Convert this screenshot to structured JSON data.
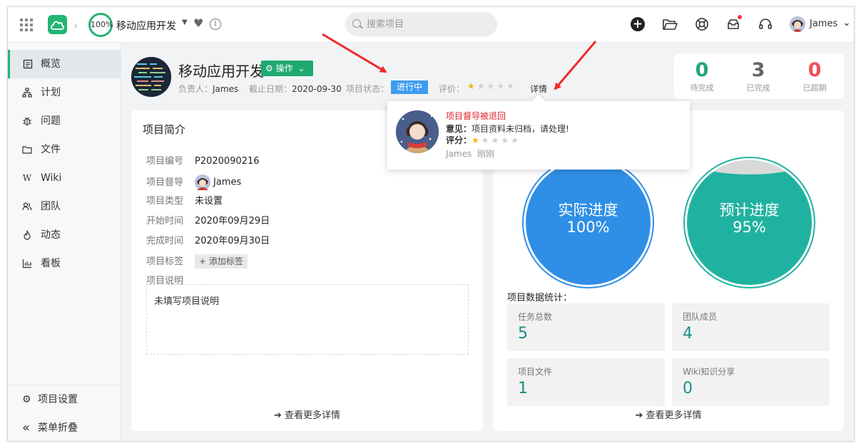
{
  "topbar": {
    "progress": "100%",
    "project_title": "移动应用开发",
    "search_placeholder": "搜索项目",
    "user_name": "James"
  },
  "sidebar": {
    "items": [
      {
        "label": "概览",
        "icon": "overview-icon"
      },
      {
        "label": "计划",
        "icon": "plan-icon"
      },
      {
        "label": "问题",
        "icon": "bug-icon"
      },
      {
        "label": "文件",
        "icon": "folder-icon"
      },
      {
        "label": "Wiki",
        "icon": "wiki-icon"
      },
      {
        "label": "团队",
        "icon": "team-icon"
      },
      {
        "label": "动态",
        "icon": "activity-icon"
      },
      {
        "label": "看板",
        "icon": "board-icon"
      }
    ],
    "settings_label": "项目设置",
    "collapse_label": "菜单折叠"
  },
  "header": {
    "name": "移动应用开发",
    "op_label": "操作",
    "owner_label": "负责人：",
    "owner": "James",
    "deadline_label": "截止日期：",
    "deadline": "2020-09-30",
    "status_label": "项目状态：",
    "status": "进行中",
    "rating_label": "评价：",
    "rating": 1,
    "rating_max": 5,
    "detail_label": "详情"
  },
  "stats": [
    {
      "num": "0",
      "label": "待完成",
      "color": "#1fa971"
    },
    {
      "num": "3",
      "label": "已完成",
      "color": "#666666"
    },
    {
      "num": "0",
      "label": "已超期",
      "color": "#f0505a"
    }
  ],
  "intro": {
    "title": "项目简介",
    "rows": [
      {
        "key": "项目编号",
        "value": "P2020090216"
      },
      {
        "key": "项目督导",
        "value": "James"
      },
      {
        "key": "项目类型",
        "value": "未设置"
      },
      {
        "key": "开始时间",
        "value": "2020年09月29日"
      },
      {
        "key": "完成时间",
        "value": "2020年09月30日"
      },
      {
        "key": "项目标签",
        "value": "添加标签"
      },
      {
        "key": "项目说明",
        "value": ""
      }
    ],
    "description": "未填写项目说明",
    "more_label": "查看更多详情"
  },
  "progress": {
    "actual_label": "实际进度",
    "actual_value": "100%",
    "planned_label": "预计进度",
    "planned_value": "95%",
    "colors": {
      "actual": "#2f8fe6",
      "planned": "#20b2a0"
    }
  },
  "data_stats": {
    "title": "项目数据统计：",
    "items": [
      {
        "label": "任务总数",
        "value": "5"
      },
      {
        "label": "团队成员",
        "value": "4"
      },
      {
        "label": "项目文件",
        "value": "1"
      },
      {
        "label": "Wiki知识分享",
        "value": "0"
      }
    ],
    "more_label": "查看更多详情"
  },
  "popover": {
    "title": "项目督导被退回",
    "opinion_label": "意见：",
    "opinion": "项目资料未归档，请处理!",
    "score_label": "评分：",
    "score": 1,
    "author": "James",
    "time": "刚刚"
  }
}
